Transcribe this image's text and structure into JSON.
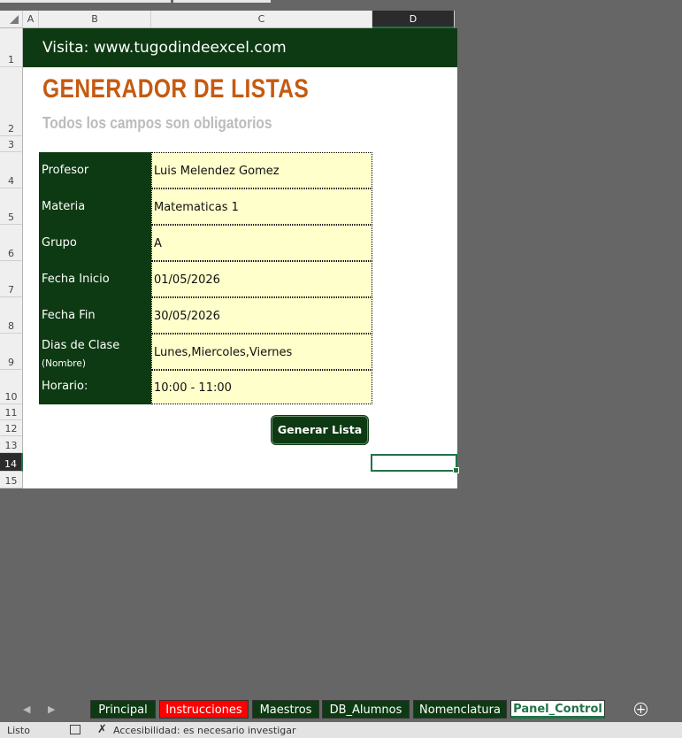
{
  "columns": [
    "A",
    "B",
    "C",
    "D"
  ],
  "selected_column": "D",
  "rows": [
    "1",
    "2",
    "3",
    "4",
    "5",
    "6",
    "7",
    "8",
    "9",
    "10",
    "11",
    "12",
    "13",
    "14",
    "15"
  ],
  "selected_row": "14",
  "banner": {
    "text": "Visita: www.tugodindeexcel.com"
  },
  "header": {
    "title": "GENERADOR DE LISTAS",
    "subtitle": "Todos los campos son obligatorios"
  },
  "form": {
    "fields": [
      {
        "label": "Profesor",
        "value": "Luis Melendez Gomez"
      },
      {
        "label": "Materia",
        "value": "Matematicas 1"
      },
      {
        "label": "Grupo",
        "value": "A"
      },
      {
        "label": "Fecha Inicio",
        "value": "01/05/2026"
      },
      {
        "label": "Fecha Fin",
        "value": "30/05/2026"
      },
      {
        "label": "Dias de Clase",
        "sublabel": "(Nombre)",
        "value": "Lunes,Miercoles,Viernes"
      },
      {
        "label": "Horario:",
        "value": "10:00 - 11:00"
      }
    ],
    "button_label": "Generar Lista"
  },
  "sheet_tabs": [
    {
      "label": "Principal",
      "color": "#0d3a12"
    },
    {
      "label": "Instrucciones",
      "color": "#ff0000"
    },
    {
      "label": "Maestros",
      "color": "#0d3a12"
    },
    {
      "label": "DB_Alumnos",
      "color": "#0d3a12"
    },
    {
      "label": "Nomenclatura",
      "color": "#0d3a12"
    },
    {
      "label": "Panel_Control",
      "color": "#ffffff",
      "active": true
    }
  ],
  "add_sheet_icon": "plus-circle-icon",
  "status": {
    "mode": "Listo",
    "accessibility": "Accesibilidad: es necesario investigar"
  },
  "colors": {
    "banner_green": "#0d3a12",
    "title_orange": "#c55a11",
    "input_fill": "#ffffcc",
    "excel_green": "#217346"
  }
}
